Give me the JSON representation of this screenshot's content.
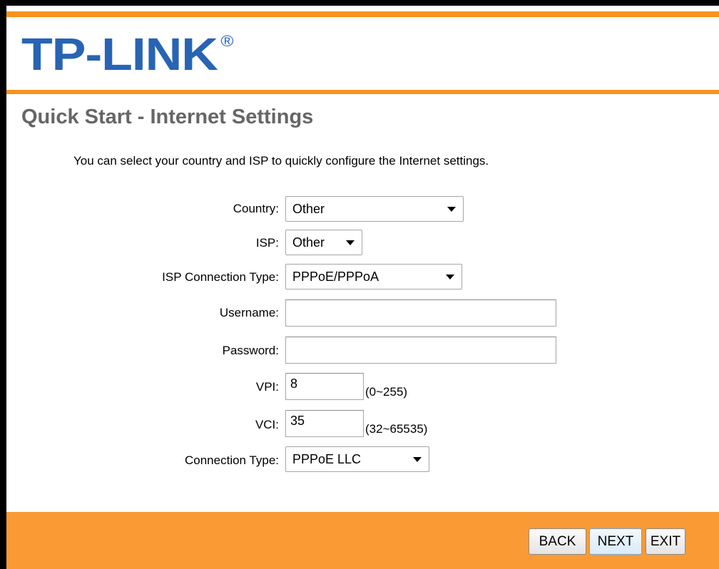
{
  "brand": {
    "logo_text": "TP-LINK",
    "registered_mark": "®",
    "logo_color": "#2864b4",
    "accent_color": "#f7931e"
  },
  "page": {
    "title": "Quick Start - Internet Settings",
    "intro": "You can select your country and ISP to quickly configure the Internet settings."
  },
  "form": {
    "country": {
      "label": "Country:",
      "value": "Other"
    },
    "isp": {
      "label": "ISP:",
      "value": "Other"
    },
    "isp_connection_type": {
      "label": "ISP Connection Type:",
      "value": "PPPoE/PPPoA"
    },
    "username": {
      "label": "Username:",
      "value": ""
    },
    "password": {
      "label": "Password:",
      "value": ""
    },
    "vpi": {
      "label": "VPI:",
      "value": "8",
      "range": "(0~255)"
    },
    "vci": {
      "label": "VCI:",
      "value": "35",
      "range": "(32~65535)"
    },
    "connection_type": {
      "label": "Connection Type:",
      "value": "PPPoE LLC"
    }
  },
  "buttons": {
    "back": "BACK",
    "next": "NEXT",
    "exit": "EXIT"
  }
}
